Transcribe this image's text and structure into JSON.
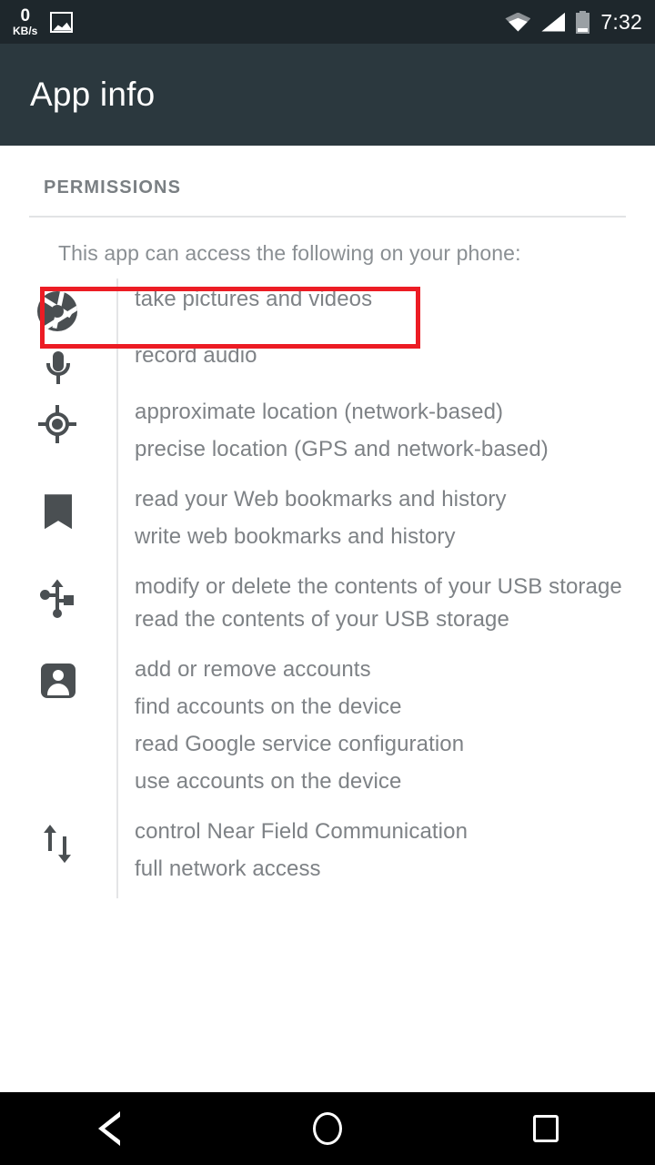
{
  "status_bar": {
    "net_speed_value": "0",
    "net_speed_unit": "KB/s",
    "image_icon": "image-icon",
    "wifi_icon": "wifi-icon",
    "signal_icon": "signal-icon",
    "battery_icon": "battery-icon",
    "time": "7:32"
  },
  "app_bar": {
    "title": "App info",
    "background": "#2b383e"
  },
  "content": {
    "section_title": "PERMISSIONS",
    "intro": "This app can access the following on your phone:",
    "permission_groups": [
      {
        "icon": "camera-aperture-icon",
        "lines": [
          "take pictures and videos"
        ],
        "highlighted": true
      },
      {
        "icon": "microphone-icon",
        "lines": [
          "record audio"
        ],
        "highlighted": false
      },
      {
        "icon": "location-crosshair-icon",
        "lines": [
          "approximate location (network-based)",
          "precise location (GPS and network-based)"
        ],
        "highlighted": false
      },
      {
        "icon": "bookmark-icon",
        "lines": [
          "read your Web bookmarks and history",
          "write web bookmarks and history"
        ],
        "highlighted": false
      },
      {
        "icon": "usb-icon",
        "lines": [
          "modify or delete the contents of your USB storage",
          "read the contents of your USB storage"
        ],
        "highlighted": false
      },
      {
        "icon": "account-person-icon",
        "lines": [
          "add or remove accounts",
          "find accounts on the device",
          "read Google service configuration",
          "use accounts on the device"
        ],
        "highlighted": false
      },
      {
        "icon": "nfc-arrows-icon",
        "lines": [
          "control Near Field Communication",
          "full network access"
        ],
        "highlighted": false
      }
    ]
  },
  "highlight": {
    "color": "#ec1c24",
    "target": "take pictures and videos"
  },
  "nav_bar": {
    "back_label": "Back",
    "home_label": "Home",
    "recents_label": "Recents"
  }
}
